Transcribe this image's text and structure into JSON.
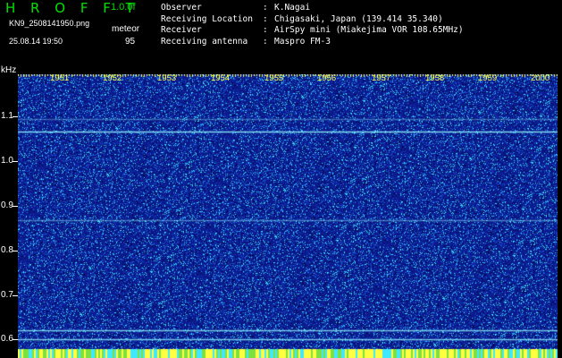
{
  "app": {
    "logo": "H R O F F T",
    "version": "1.0.0f",
    "filename": "KN9_2508141950.png",
    "meteor_label": "meteor",
    "timestamp": "25.08.14 19:50",
    "meteor_count": "95"
  },
  "info": {
    "rows": [
      {
        "key": "Observer",
        "value": "K.Nagai"
      },
      {
        "key": "Receiving Location",
        "value": "Chigasaki, Japan (139.414 35.340)"
      },
      {
        "key": "Receiver",
        "value": "AirSpy mini (Miakejima VOR 108.65MHz)"
      },
      {
        "key": "Receiving antenna",
        "value": "Maspro FM-3"
      }
    ],
    "colon": ":"
  },
  "axes": {
    "y_unit": "kHz",
    "y_ticks": [
      "1.1",
      "1.0",
      "0.9",
      "0.8",
      "0.7",
      "0.6"
    ],
    "x_ticks": [
      "1951",
      "1952",
      "1953",
      "1954",
      "1955",
      "1956",
      "1957",
      "1958",
      "1959",
      "2000"
    ]
  },
  "colors": {
    "background": "#0b1a8c",
    "noise_cyan": "#40e8ff",
    "text_green": "#00e000",
    "tick_yellow": "#ffff40"
  }
}
